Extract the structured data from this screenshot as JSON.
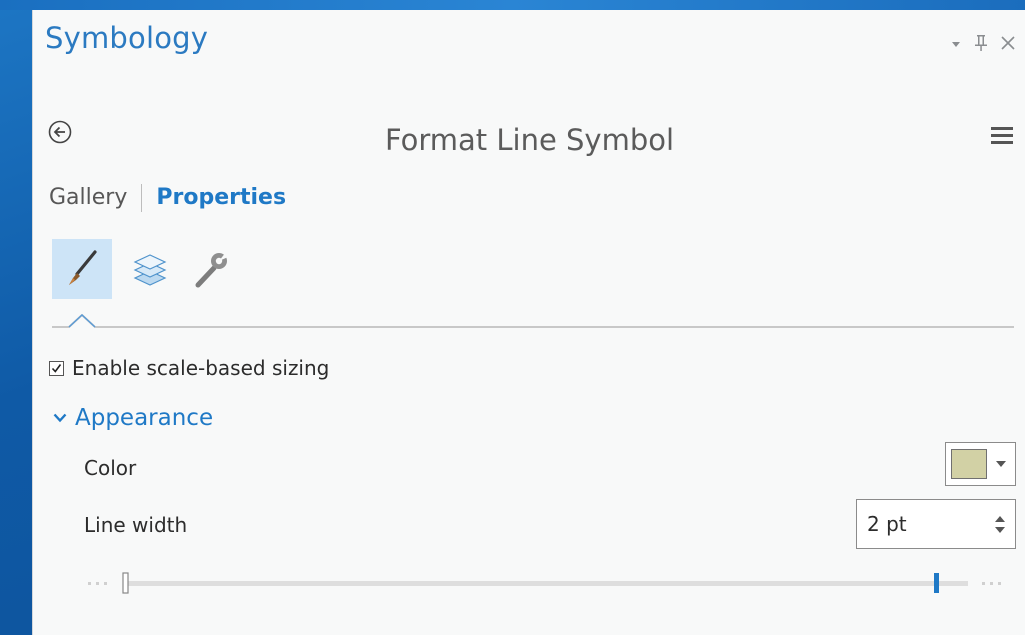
{
  "panel": {
    "title": "Symbology",
    "controls": [
      "pin-dropdown-icon",
      "pin-icon",
      "close-icon"
    ]
  },
  "header": {
    "back_icon": "back-arrow-icon",
    "title": "Format Line Symbol",
    "menu_icon": "hamburger-menu-icon"
  },
  "tabs": {
    "gallery": "Gallery",
    "properties": "Properties",
    "active": "properties"
  },
  "toolbar": {
    "items": [
      {
        "icon": "paintbrush-icon",
        "active": true
      },
      {
        "icon": "layers-icon",
        "active": false
      },
      {
        "icon": "wrench-icon",
        "active": false
      }
    ]
  },
  "options": {
    "scale_sizing_label": "Enable scale-based sizing",
    "scale_sizing_checked": true
  },
  "appearance": {
    "section_label": "Appearance",
    "color_label": "Color",
    "color_value": "#d2d1a5",
    "line_width_label": "Line width",
    "line_width_value": "2 pt",
    "slider_level": 0.96
  },
  "colors": {
    "accent": "#1f79c6",
    "title_blue": "#2b7ac1",
    "active_tool_bg": "#cde4f7"
  }
}
